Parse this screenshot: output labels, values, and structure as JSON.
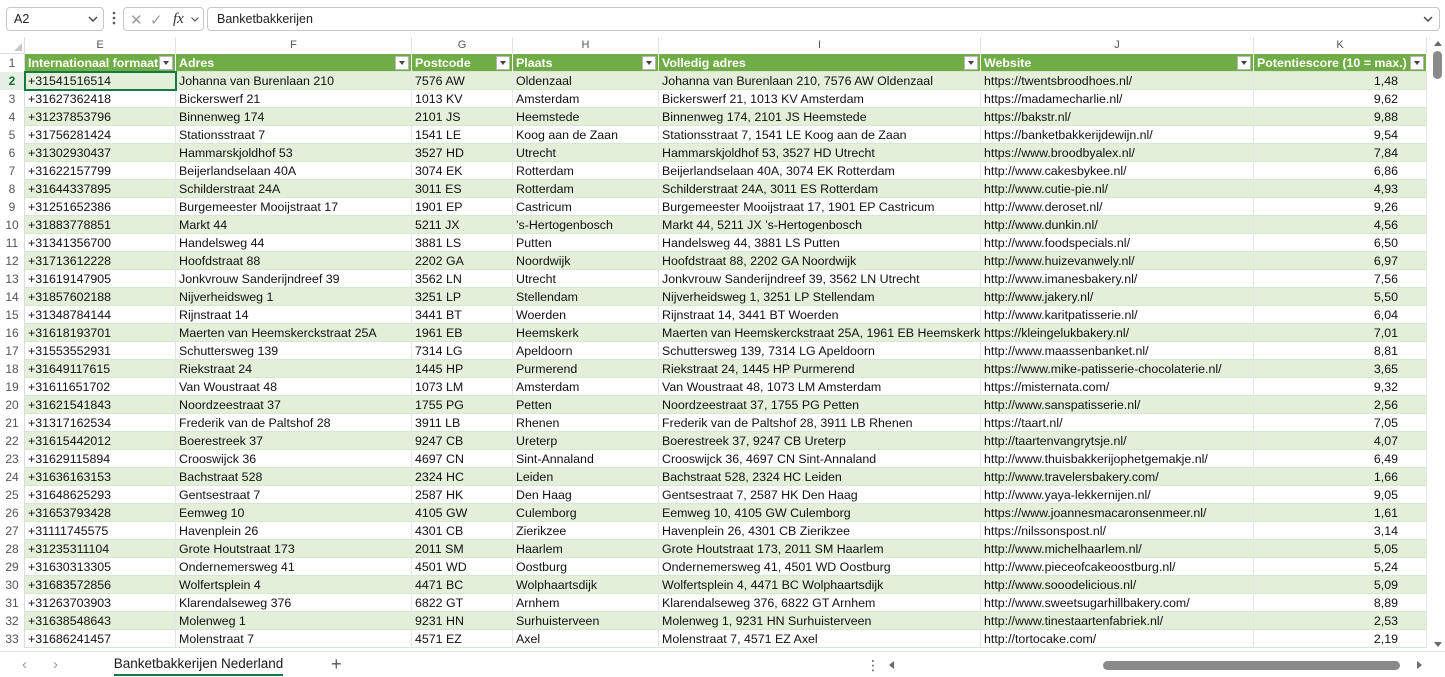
{
  "formula_bar": {
    "name_box": "A2",
    "cancel_icon": "✕",
    "enter_icon": "✓",
    "fx_label": "fx",
    "content": "Banketbakkerijen"
  },
  "columns": [
    "E",
    "F",
    "G",
    "H",
    "I",
    "J",
    "K"
  ],
  "selected_row": 2,
  "header_row_number": 1,
  "headers": [
    "Internationaal formaat",
    "Adres",
    "Postcode",
    "Plaats",
    "Volledig adres",
    "Website",
    "Potentiescore (10 = max.)"
  ],
  "rows": [
    {
      "n": 2,
      "c": [
        "+31541516514",
        "Johanna van Burenlaan 210",
        "7576 AW",
        "Oldenzaal",
        "Johanna van Burenlaan 210, 7576 AW Oldenzaal",
        "https://twentsbroodhoes.nl/",
        "1,48"
      ]
    },
    {
      "n": 3,
      "c": [
        "+31627362418",
        "Bickerswerf 21",
        "1013 KV",
        "Amsterdam",
        "Bickerswerf 21, 1013 KV Amsterdam",
        "https://madamecharlie.nl/",
        "9,62"
      ]
    },
    {
      "n": 4,
      "c": [
        "+31237853796",
        "Binnenweg 174",
        "2101 JS",
        "Heemstede",
        "Binnenweg 174, 2101 JS Heemstede",
        "https://bakstr.nl/",
        "9,88"
      ]
    },
    {
      "n": 5,
      "c": [
        "+31756281424",
        "Stationsstraat 7",
        "1541 LE",
        "Koog aan de Zaan",
        "Stationsstraat 7, 1541 LE Koog aan de Zaan",
        "https://banketbakkerijdewijn.nl/",
        "9,54"
      ]
    },
    {
      "n": 6,
      "c": [
        "+31302930437",
        "Hammarskjoldhof 53",
        "3527 HD",
        "Utrecht",
        "Hammarskjoldhof 53, 3527 HD Utrecht",
        "https://www.broodbyalex.nl/",
        "7,84"
      ]
    },
    {
      "n": 7,
      "c": [
        "+31622157799",
        "Beijerlandselaan 40A",
        "3074 EK",
        "Rotterdam",
        "Beijerlandselaan 40A, 3074 EK Rotterdam",
        "http://www.cakesbykee.nl/",
        "6,86"
      ]
    },
    {
      "n": 8,
      "c": [
        "+31644337895",
        "Schilderstraat 24A",
        "3011 ES",
        "Rotterdam",
        "Schilderstraat 24A, 3011 ES Rotterdam",
        "http://www.cutie-pie.nl/",
        "4,93"
      ]
    },
    {
      "n": 9,
      "c": [
        "+31251652386",
        "Burgemeester Mooijstraat 17",
        "1901 EP",
        "Castricum",
        "Burgemeester Mooijstraat 17, 1901 EP Castricum",
        "http://www.deroset.nl/",
        "9,26"
      ]
    },
    {
      "n": 10,
      "c": [
        "+31883778851",
        "Markt 44",
        "5211 JX",
        "’s-Hertogenbosch",
        "Markt 44, 5211 JX ’s-Hertogenbosch",
        "http://www.dunkin.nl/",
        "4,56"
      ]
    },
    {
      "n": 11,
      "c": [
        "+31341356700",
        "Handelsweg 44",
        "3881 LS",
        "Putten",
        "Handelsweg 44, 3881 LS Putten",
        "http://www.foodspecials.nl/",
        "6,50"
      ]
    },
    {
      "n": 12,
      "c": [
        "+31713612228",
        "Hoofdstraat 88",
        "2202 GA",
        "Noordwijk",
        "Hoofdstraat 88, 2202 GA Noordwijk",
        "http://www.huizevanwely.nl/",
        "6,97"
      ]
    },
    {
      "n": 13,
      "c": [
        "+31619147905",
        "Jonkvrouw Sanderijndreef 39",
        "3562 LN",
        "Utrecht",
        "Jonkvrouw Sanderijndreef 39, 3562 LN Utrecht",
        "http://www.imanesbakery.nl/",
        "7,56"
      ]
    },
    {
      "n": 14,
      "c": [
        "+31857602188",
        "Nijverheidsweg 1",
        "3251 LP",
        "Stellendam",
        "Nijverheidsweg 1, 3251 LP Stellendam",
        "http://www.jakery.nl/",
        "5,50"
      ]
    },
    {
      "n": 15,
      "c": [
        "+31348784144",
        "Rijnstraat 14",
        "3441 BT",
        "Woerden",
        "Rijnstraat 14, 3441 BT Woerden",
        "http://www.karitpatisserie.nl/",
        "6,04"
      ]
    },
    {
      "n": 16,
      "c": [
        "+31618193701",
        "Maerten van Heemskerckstraat 25A",
        "1961 EB",
        "Heemskerk",
        "Maerten van Heemskerckstraat 25A, 1961 EB Heemskerk",
        "https://kleingelukbakery.nl/",
        "7,01"
      ]
    },
    {
      "n": 17,
      "c": [
        "+31553552931",
        "Schuttersweg 139",
        "7314 LG",
        "Apeldoorn",
        "Schuttersweg 139, 7314 LG Apeldoorn",
        "http://www.maassenbanket.nl/",
        "8,81"
      ]
    },
    {
      "n": 18,
      "c": [
        "+31649117615",
        "Riekstraat 24",
        "1445 HP",
        "Purmerend",
        "Riekstraat 24, 1445 HP Purmerend",
        "https://www.mike-patisserie-chocolaterie.nl/",
        "3,65"
      ]
    },
    {
      "n": 19,
      "c": [
        "+31611651702",
        "Van Woustraat 48",
        "1073 LM",
        "Amsterdam",
        "Van Woustraat 48, 1073 LM Amsterdam",
        "https://misternata.com/",
        "9,32"
      ]
    },
    {
      "n": 20,
      "c": [
        "+31621541843",
        "Noordzeestraat 37",
        "1755 PG",
        "Petten",
        "Noordzeestraat 37, 1755 PG Petten",
        "http://www.sanspatisserie.nl/",
        "2,56"
      ]
    },
    {
      "n": 21,
      "c": [
        "+31317162534",
        "Frederik van de Paltshof 28",
        "3911 LB",
        "Rhenen",
        "Frederik van de Paltshof 28, 3911 LB Rhenen",
        "https://taart.nl/",
        "7,05"
      ]
    },
    {
      "n": 22,
      "c": [
        "+31615442012",
        "Boerestreek 37",
        "9247 CB",
        "Ureterp",
        "Boerestreek 37, 9247 CB Ureterp",
        "http://taartenvangrytsje.nl/",
        "4,07"
      ]
    },
    {
      "n": 23,
      "c": [
        "+31629115894",
        "Crooswijck 36",
        "4697 CN",
        "Sint-Annaland",
        "Crooswijck 36, 4697 CN Sint-Annaland",
        "http://www.thuisbakkerijophetgemakje.nl/",
        "6,49"
      ]
    },
    {
      "n": 24,
      "c": [
        "+31636163153",
        "Bachstraat 528",
        "2324 HC",
        "Leiden",
        "Bachstraat 528, 2324 HC Leiden",
        "http://www.travelersbakery.com/",
        "1,66"
      ]
    },
    {
      "n": 25,
      "c": [
        "+31648625293",
        "Gentsestraat 7",
        "2587 HK",
        "Den Haag",
        "Gentsestraat 7, 2587 HK Den Haag",
        "http://www.yaya-lekkernijen.nl/",
        "9,05"
      ]
    },
    {
      "n": 26,
      "c": [
        "+31653793428",
        "Eemweg 10",
        "4105 GW",
        "Culemborg",
        "Eemweg 10, 4105 GW Culemborg",
        "https://www.joannesmacaronsenmeer.nl/",
        "1,61"
      ]
    },
    {
      "n": 27,
      "c": [
        "+31111745575",
        "Havenplein 26",
        "4301 CB",
        "Zierikzee",
        "Havenplein 26, 4301 CB Zierikzee",
        "https://nilssonspost.nl/",
        "3,14"
      ]
    },
    {
      "n": 28,
      "c": [
        "+31235311104",
        "Grote Houtstraat 173",
        "2011 SM",
        "Haarlem",
        "Grote Houtstraat 173, 2011 SM Haarlem",
        "http://www.michelhaarlem.nl/",
        "5,05"
      ]
    },
    {
      "n": 29,
      "c": [
        "+31630313305",
        "Ondernemersweg 41",
        "4501 WD",
        "Oostburg",
        "Ondernemersweg 41, 4501 WD Oostburg",
        "http://www.pieceofcakeoostburg.nl/",
        "5,24"
      ]
    },
    {
      "n": 30,
      "c": [
        "+31683572856",
        "Wolfertsplein 4",
        "4471 BC",
        "Wolphaartsdijk",
        "Wolfertsplein 4, 4471 BC Wolphaartsdijk",
        "http://www.sooodelicious.nl/",
        "5,09"
      ]
    },
    {
      "n": 31,
      "c": [
        "+31263703903",
        "Klarendalseweg 376",
        "6822 GT",
        "Arnhem",
        "Klarendalseweg 376, 6822 GT Arnhem",
        "http://www.sweetsugarhillbakery.com/",
        "8,89"
      ]
    },
    {
      "n": 32,
      "c": [
        "+31638548643",
        "Molenweg 1",
        "9231 HN",
        "Surhuisterveen",
        "Molenweg 1, 9231 HN Surhuisterveen",
        "http://www.tinestaartenfabriek.nl/",
        "2,53"
      ]
    },
    {
      "n": 33,
      "c": [
        "+31686241457",
        "Molenstraat 7",
        "4571 EZ",
        "Axel",
        "Molenstraat 7, 4571 EZ Axel",
        "http://tortocake.com/",
        "2,19"
      ]
    }
  ],
  "sheet_tabs": {
    "active": "Banketbakkerijen Nederland",
    "add_label": "+",
    "prev_icon": "‹",
    "next_icon": "›",
    "more_icon": "⋮"
  },
  "colors": {
    "header_fill": "#70ad47",
    "band_fill": "#e3efd9",
    "selection": "#107c41"
  }
}
